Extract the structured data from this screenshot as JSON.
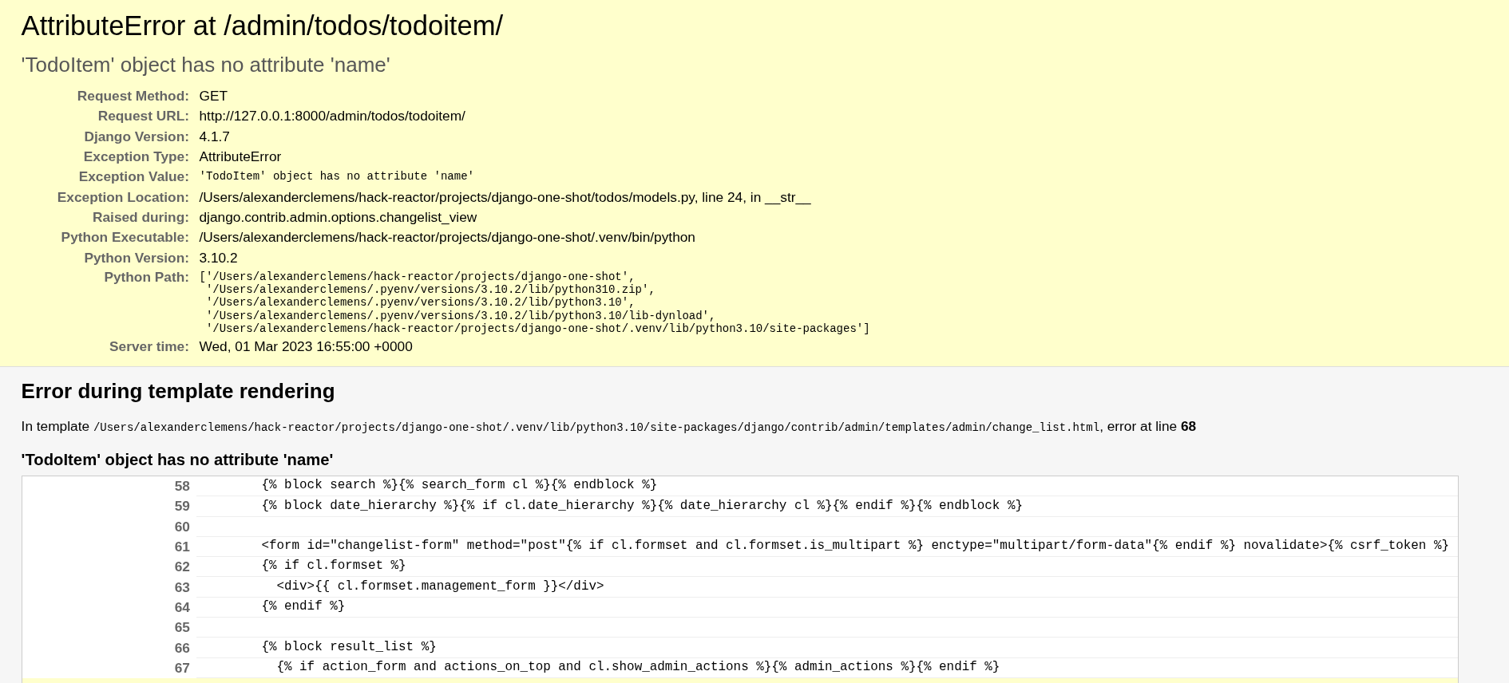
{
  "page": {
    "title": "AttributeError at /admin/todos/todoitem/",
    "exception_value": "'TodoItem' object has no attribute 'name'"
  },
  "summary": [
    {
      "label": "Request Method:",
      "value": "GET",
      "kind": "text"
    },
    {
      "label": "Request URL:",
      "value": "http://127.0.0.1:8000/admin/todos/todoitem/",
      "kind": "text"
    },
    {
      "label": "Django Version:",
      "value": "4.1.7",
      "kind": "text"
    },
    {
      "label": "Exception Type:",
      "value": "AttributeError",
      "kind": "text"
    },
    {
      "label": "Exception Value:",
      "value": "'TodoItem' object has no attribute 'name'",
      "kind": "code"
    },
    {
      "label": "Exception Location:",
      "value": "/Users/alexanderclemens/hack-reactor/projects/django-one-shot/todos/models.py, line 24, in __str__",
      "kind": "text"
    },
    {
      "label": "Raised during:",
      "value": "django.contrib.admin.options.changelist_view",
      "kind": "text"
    },
    {
      "label": "Python Executable:",
      "value": "/Users/alexanderclemens/hack-reactor/projects/django-one-shot/.venv/bin/python",
      "kind": "text"
    },
    {
      "label": "Python Version:",
      "value": "3.10.2",
      "kind": "text"
    },
    {
      "label": "Python Path:",
      "kind": "lines",
      "lines": [
        "['/Users/alexanderclemens/hack-reactor/projects/django-one-shot',",
        " '/Users/alexanderclemens/.pyenv/versions/3.10.2/lib/python310.zip',",
        " '/Users/alexanderclemens/.pyenv/versions/3.10.2/lib/python3.10',",
        " '/Users/alexanderclemens/.pyenv/versions/3.10.2/lib/python3.10/lib-dynload',",
        " '/Users/alexanderclemens/hack-reactor/projects/django-one-shot/.venv/lib/python3.10/site-packages']"
      ]
    },
    {
      "label": "Server time:",
      "value": "Wed, 01 Mar 2023 16:55:00 +0000",
      "kind": "text"
    }
  ],
  "template": {
    "heading": "Error during template rendering",
    "text_before": "In template",
    "path": "/Users/alexanderclemens/hack-reactor/projects/django-one-shot/.venv/lib/python3.10/site-packages/django/contrib/admin/templates/admin/change_list.html",
    "text_after": ", error at line **68**",
    "message": "'TodoItem' object has no attribute 'name'",
    "lines": [
      {
        "number": "58",
        "code": "        {% block search %}{% search_form cl %}{% endblock %}",
        "error": false
      },
      {
        "number": "59",
        "code": "        {% block date_hierarchy %}{% if cl.date_hierarchy %}{% date_hierarchy cl %}{% endif %}{% endblock %}",
        "error": false
      },
      {
        "number": "60",
        "error": false
      },
      {
        "number": "61",
        "code": "        <form id=\"changelist-form\" method=\"post\"{% if cl.formset and cl.formset.is_multipart %} enctype=\"multipart/form-data\"{% endif %} novalidate>{% csrf_token %}",
        "error": false
      },
      {
        "number": "62",
        "code": "        {% if cl.formset %}",
        "error": false
      },
      {
        "number": "63",
        "code": "          <div>{{ cl.formset.management_form }}</div>",
        "error": false
      },
      {
        "number": "64",
        "code": "        {% endif %}",
        "error": false
      },
      {
        "number": "65",
        "error": false
      },
      {
        "number": "66",
        "code": "        {% block result_list %}",
        "error": false
      },
      {
        "number": "67",
        "code": "          {% if action_form and actions_on_top and cl.show_admin_actions %}{% admin_actions %}{% endif %}",
        "error": false
      },
      {
        "error": true
      }
    ]
  }
}
